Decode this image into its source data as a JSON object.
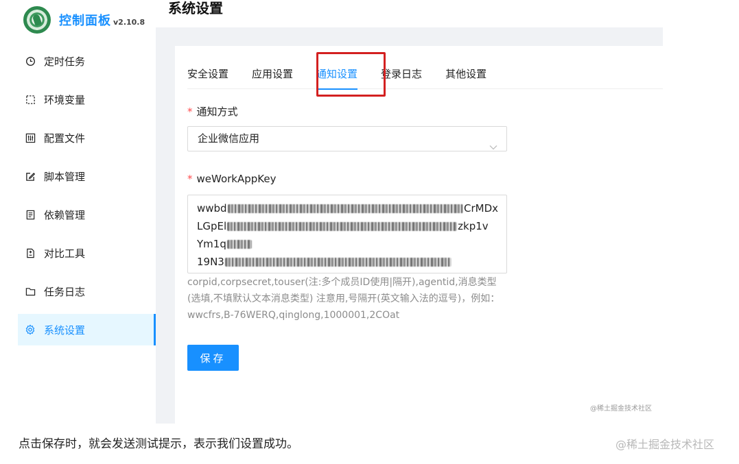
{
  "app": {
    "brand": "控制面板",
    "version": "v2.10.8",
    "page_title": "系统设置"
  },
  "sidebar": {
    "items": [
      {
        "label": "定时任务",
        "icon": "clock-icon"
      },
      {
        "label": "环境变量",
        "icon": "dashed-square-icon"
      },
      {
        "label": "配置文件",
        "icon": "sliders-icon"
      },
      {
        "label": "脚本管理",
        "icon": "edit-icon"
      },
      {
        "label": "依赖管理",
        "icon": "list-doc-icon"
      },
      {
        "label": "对比工具",
        "icon": "diff-doc-icon"
      },
      {
        "label": "任务日志",
        "icon": "folder-icon"
      },
      {
        "label": "系统设置",
        "icon": "gear-icon",
        "active": true
      }
    ]
  },
  "tabs": [
    {
      "label": "安全设置"
    },
    {
      "label": "应用设置"
    },
    {
      "label": "通知设置",
      "active": true
    },
    {
      "label": "登录日志"
    },
    {
      "label": "其他设置"
    }
  ],
  "form": {
    "notify_method_label": "通知方式",
    "notify_method_value": "企业微信应用",
    "key_label": "weWorkAppKey",
    "key_lines": [
      {
        "start": "wwbd",
        "end": "CrMDx"
      },
      {
        "start": "LGpEl",
        "end": "zkp1v"
      },
      {
        "start": "Ym1q",
        "end": ""
      },
      {
        "start": "19N3",
        "end": ""
      }
    ],
    "help_text": "corpid,corpsecret,touser(注:多个成员ID使用|隔开),agentid,消息类型(选填,不填默认文本消息类型) 注意用,号隔开(英文输入法的逗号)，例如：wwcfrs,B-76WERQ,qinglong,1000001,2COat",
    "save_label": "保存"
  },
  "watermark_small": "@稀土掘金技术社区",
  "caption": "点击保存时，就会发送测试提示，表示我们设置成功。",
  "watermark_big": "@稀土掘金技术社区",
  "colors": {
    "accent": "#1890ff",
    "highlight_box": "#d32020",
    "required": "#ff4d4f"
  }
}
